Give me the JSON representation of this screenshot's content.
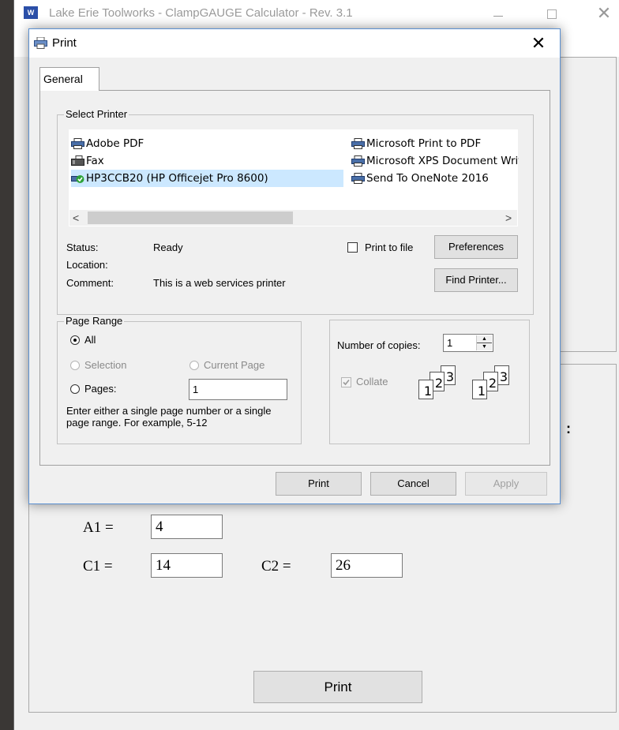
{
  "background_window": {
    "title": "Lake Erie Toolworks - ClampGAUGE Calculator - Rev. 3.1",
    "close_glyph": "✕",
    "partial_label": ":",
    "fields": [
      {
        "label": "A1 =",
        "value": "4"
      },
      {
        "label": "C1 =",
        "value": "14"
      },
      {
        "label": "C2 =",
        "value": "26"
      }
    ],
    "print_button": "Print"
  },
  "dialog": {
    "title": "Print",
    "close_glyph": "✕",
    "tab_label": "General",
    "select_printer": {
      "label": "Select Printer",
      "printers": [
        {
          "name": "Adobe PDF",
          "icon": "printer-icon",
          "selected": false
        },
        {
          "name": "Fax",
          "icon": "fax-icon",
          "selected": false
        },
        {
          "name": "HP3CCB20 (HP Officejet Pro 8600)",
          "icon": "printer-default-icon",
          "selected": true
        },
        {
          "name": "Microsoft Print to PDF",
          "icon": "printer-icon",
          "selected": false
        },
        {
          "name": "Microsoft XPS Document Writer",
          "icon": "printer-icon",
          "selected": false
        },
        {
          "name": "Send To OneNote 2016",
          "icon": "printer-icon",
          "selected": false
        }
      ],
      "scroll_left": "<",
      "scroll_right": ">",
      "status_label": "Status:",
      "status_value": "Ready",
      "location_label": "Location:",
      "location_value": "",
      "comment_label": "Comment:",
      "comment_value": "This is a web services printer",
      "print_to_file_label": "Print to file",
      "print_to_file_checked": false,
      "preferences_label": "Preferences",
      "find_printer_label": "Find Printer..."
    },
    "page_range": {
      "label": "Page Range",
      "all_label": "All",
      "selection_label": "Selection",
      "current_page_label": "Current Page",
      "pages_label": "Pages:",
      "pages_value": "1",
      "hint_line1": "Enter either a single page number or a single",
      "hint_line2": "page range.  For example, 5-12",
      "selected_option": "All"
    },
    "copies": {
      "label": "Number of copies:",
      "value": "1",
      "collate_label": "Collate",
      "collate_checked": true,
      "collate_pages": [
        "1",
        "2",
        "3"
      ]
    },
    "buttons": {
      "print": "Print",
      "cancel": "Cancel",
      "apply": "Apply"
    }
  }
}
